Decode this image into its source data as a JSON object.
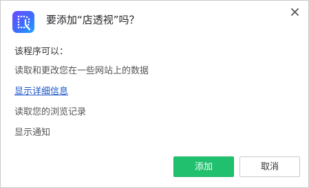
{
  "dialog": {
    "title": "要添加“店透视”吗？",
    "close_icon": "close-icon",
    "app_icon": "extension-logo-icon",
    "brand_colors": {
      "icon_gradient_start": "#6a4bff",
      "icon_gradient_end": "#1aa8ff",
      "add_button": "#20c06e",
      "link": "#1a55c8"
    }
  },
  "permissions": {
    "heading": "该程序可以：",
    "items": [
      "读取和更改您在一些网站上的数据",
      "读取您的浏览记录",
      "显示通知"
    ],
    "details_link": "显示详细信息"
  },
  "buttons": {
    "add_label": "添加",
    "cancel_label": "取消"
  }
}
